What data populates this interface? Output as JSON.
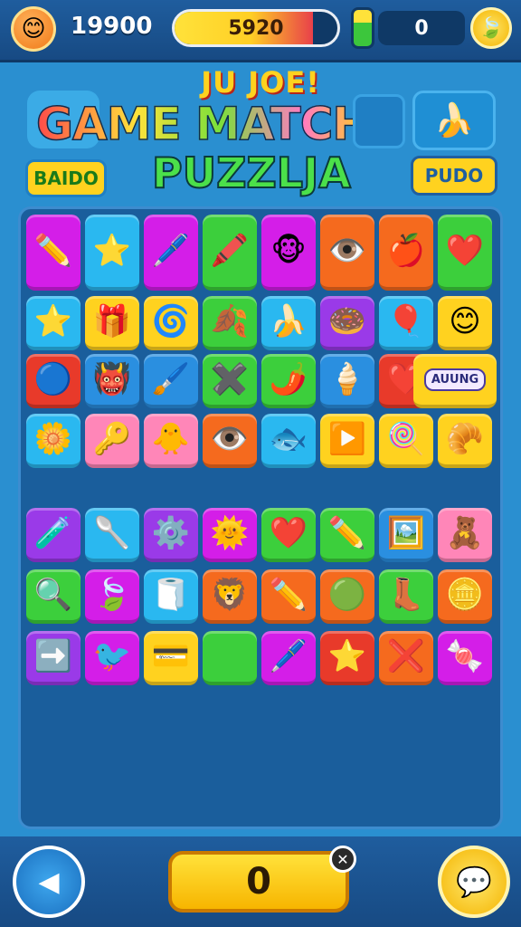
{
  "hud": {
    "score": "19900",
    "progress_label": "5920",
    "progress_fraction": 0.85,
    "coins": "0",
    "avatar_glyph": "😊",
    "settings_glyph": "🍃"
  },
  "banner": {
    "subtitle": "JU JOE!",
    "title_line1": "GAME MATCH",
    "title_line2": "PUZZLJA",
    "left_pill": "BAIDO",
    "right_pill": "PUDO",
    "banana_glyph": "🍌"
  },
  "colors": {
    "magenta": "#d41ee8",
    "cyan": "#2ab8f0",
    "green": "#3ccf3c",
    "orange": "#f56a1e",
    "yellow": "#ffd21f",
    "red": "#e83a2a",
    "blue": "#2a8fe0",
    "purple": "#9a3ae8",
    "pink": "#ff86b8"
  },
  "tiles": [
    {
      "name": "pencil-tile",
      "glyph": "✏️",
      "color": "magenta"
    },
    {
      "name": "star-face-tile",
      "glyph": "⭐",
      "color": "cyan"
    },
    {
      "name": "pen-tile",
      "glyph": "🖊️",
      "color": "magenta"
    },
    {
      "name": "crayons-tile",
      "glyph": "🖍️",
      "color": "green"
    },
    {
      "name": "monster-tile",
      "glyph": "🐵",
      "color": "magenta"
    },
    {
      "name": "eye-tile",
      "glyph": "👁️",
      "color": "orange"
    },
    {
      "name": "apple-tile",
      "glyph": "🍎",
      "color": "orange"
    },
    {
      "name": "heart-tile",
      "glyph": "❤️",
      "color": "green"
    },
    {
      "name": "star-tile",
      "glyph": "⭐",
      "color": "cyan"
    },
    {
      "name": "gift-tile",
      "glyph": "🎁",
      "color": "yellow"
    },
    {
      "name": "shell-tile",
      "glyph": "🌀",
      "color": "yellow"
    },
    {
      "name": "leaf-tile",
      "glyph": "🍂",
      "color": "green"
    },
    {
      "name": "banana-tile",
      "glyph": "🍌",
      "color": "cyan"
    },
    {
      "name": "donut-tile",
      "glyph": "🍩",
      "color": "purple"
    },
    {
      "name": "balloon-tile",
      "glyph": "🎈",
      "color": "cyan"
    },
    {
      "name": "face-tile",
      "glyph": "😊",
      "color": "yellow"
    },
    {
      "name": "ball-tile",
      "glyph": "🔵",
      "color": "red"
    },
    {
      "name": "creature-tile",
      "glyph": "👹",
      "color": "blue"
    },
    {
      "name": "brush-tile",
      "glyph": "🖌️",
      "color": "blue"
    },
    {
      "name": "cross-tile",
      "glyph": "✖️",
      "color": "green"
    },
    {
      "name": "chili-tile",
      "glyph": "🌶️",
      "color": "green"
    },
    {
      "name": "cone-tile",
      "glyph": "🍦",
      "color": "blue"
    },
    {
      "name": "heart-tile",
      "glyph": "❤️",
      "color": "red"
    },
    {
      "name": "apple-tile",
      "glyph": "🍎",
      "color": "cyan"
    },
    {
      "name": "flower-tile",
      "glyph": "🌼",
      "color": "cyan"
    },
    {
      "name": "key-tile",
      "glyph": "🔑",
      "color": "pink"
    },
    {
      "name": "chick-tile",
      "glyph": "🐥",
      "color": "pink"
    },
    {
      "name": "eye-tile",
      "glyph": "👁️",
      "color": "orange"
    },
    {
      "name": "fish-tile",
      "glyph": "🐟",
      "color": "cyan"
    },
    {
      "name": "play-tile",
      "glyph": "▶️",
      "color": "yellow"
    },
    {
      "name": "lollipop-tile",
      "glyph": "🍭",
      "color": "yellow"
    },
    {
      "name": "bread-tile",
      "glyph": "🥐",
      "color": "yellow"
    },
    {
      "name": "bottle-tile",
      "glyph": "🧪",
      "color": "purple"
    },
    {
      "name": "spoon-tile",
      "glyph": "🥄",
      "color": "cyan"
    },
    {
      "name": "gear-tile",
      "glyph": "⚙️",
      "color": "purple"
    },
    {
      "name": "sun-tile",
      "glyph": "🌞",
      "color": "magenta"
    },
    {
      "name": "heart-tile",
      "glyph": "❤️",
      "color": "green"
    },
    {
      "name": "pencil-tile",
      "glyph": "✏️",
      "color": "green"
    },
    {
      "name": "frame-tile",
      "glyph": "🖼️",
      "color": "blue"
    },
    {
      "name": "toy-tile",
      "glyph": "🧸",
      "color": "pink"
    },
    {
      "name": "magnifier-tile",
      "glyph": "🔍",
      "color": "green"
    },
    {
      "name": "leaf-tile",
      "glyph": "🍃",
      "color": "magenta"
    },
    {
      "name": "roll-tile",
      "glyph": "🧻",
      "color": "cyan"
    },
    {
      "name": "lion-tile",
      "glyph": "🦁",
      "color": "orange"
    },
    {
      "name": "pencil-tile",
      "glyph": "✏️",
      "color": "orange"
    },
    {
      "name": "ball-tile",
      "glyph": "🟢",
      "color": "orange"
    },
    {
      "name": "boot-tile",
      "glyph": "👢",
      "color": "green"
    },
    {
      "name": "coin-tile",
      "glyph": "🪙",
      "color": "orange"
    },
    {
      "name": "arrow-tile",
      "glyph": "➡️",
      "color": "purple"
    },
    {
      "name": "bird-tile",
      "glyph": "🐦",
      "color": "magenta"
    },
    {
      "name": "card-tile",
      "glyph": "💳",
      "color": "yellow"
    },
    {
      "name": "plain-tile",
      "glyph": "",
      "color": "green"
    },
    {
      "name": "pen-tile",
      "glyph": "🖊️",
      "color": "magenta"
    },
    {
      "name": "star-tile",
      "glyph": "⭐",
      "color": "red"
    },
    {
      "name": "x-tile",
      "glyph": "❌",
      "color": "orange"
    },
    {
      "name": "candy-tile",
      "glyph": "🍬",
      "color": "magenta"
    }
  ],
  "special_tile_label": "AUUNG",
  "footer": {
    "back_glyph": "◀",
    "center_value": "0",
    "close_glyph": "✕",
    "chat_glyph": "💬"
  }
}
